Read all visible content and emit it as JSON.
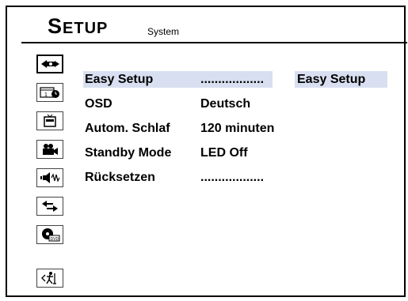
{
  "header": {
    "title_initial": "S",
    "title_rest": "ETUP",
    "subtitle": "System"
  },
  "sidebar": {
    "icons": [
      {
        "name": "system-icon",
        "active": true
      },
      {
        "name": "timer-icon",
        "active": false
      },
      {
        "name": "tv-icon",
        "active": false
      },
      {
        "name": "camera-icon",
        "active": false
      },
      {
        "name": "audio-icon",
        "active": false
      },
      {
        "name": "transfer-icon",
        "active": false
      },
      {
        "name": "dvd-icon",
        "active": false
      },
      {
        "name": "exit-icon",
        "active": false
      }
    ]
  },
  "menu": {
    "items": [
      {
        "label": "Easy Setup",
        "value": "..................",
        "highlighted": true
      },
      {
        "label": "OSD",
        "value": "Deutsch"
      },
      {
        "label": "Autom. Schlaf",
        "value": "120 minuten"
      },
      {
        "label": "Standby Mode",
        "value": "LED Off"
      },
      {
        "label": "Rücksetzen",
        "value": ".................."
      }
    ]
  },
  "submenu": {
    "selected": "Easy Setup"
  },
  "colors": {
    "highlight": "#d8dff0",
    "border": "#000000"
  }
}
